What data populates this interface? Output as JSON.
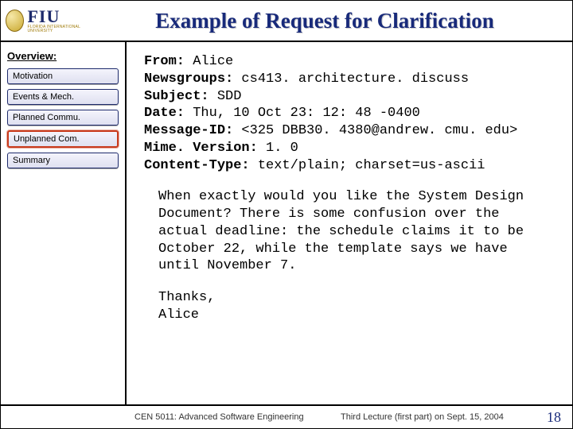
{
  "header": {
    "logo_text": "FIU",
    "logo_sub": "FLORIDA INTERNATIONAL UNIVERSITY",
    "title": "Example of Request for Clarification"
  },
  "sidebar": {
    "heading": "Overview:",
    "items": [
      {
        "label": "Motivation",
        "active": false
      },
      {
        "label": "Events & Mech.",
        "active": false
      },
      {
        "label": "Planned Commu.",
        "active": false
      },
      {
        "label": "Unplanned Com.",
        "active": true
      },
      {
        "label": "Summary",
        "active": false
      }
    ]
  },
  "message": {
    "headers": {
      "from_label": "From:",
      "from_value": " Alice",
      "newsgroups_label": "Newsgroups:",
      "newsgroups_value": " cs413. architecture. discuss",
      "subject_label": "Subject:",
      "subject_value": " SDD",
      "date_label": "Date:",
      "date_value": " Thu, 10 Oct 23: 12: 48 -0400",
      "messageid_label": "Message-ID:",
      "messageid_value": " <325 DBB30. 4380@andrew. cmu. edu>",
      "mime_label": "Mime. Version:",
      "mime_value": " 1. 0",
      "contenttype_label": "Content-Type:",
      "contenttype_value": " text/plain; charset=us-ascii"
    },
    "body": "When exactly would you like the System Design Document? There is some confusion over the actual deadline: the schedule claims it to be October 22, while the template says we have until November 7.",
    "closing_thanks": "Thanks,",
    "closing_name": "Alice"
  },
  "footer": {
    "course": "CEN 5011: Advanced Software Engineering",
    "lecture": "Third Lecture (first part) on Sept. 15, 2004",
    "page": "18"
  }
}
